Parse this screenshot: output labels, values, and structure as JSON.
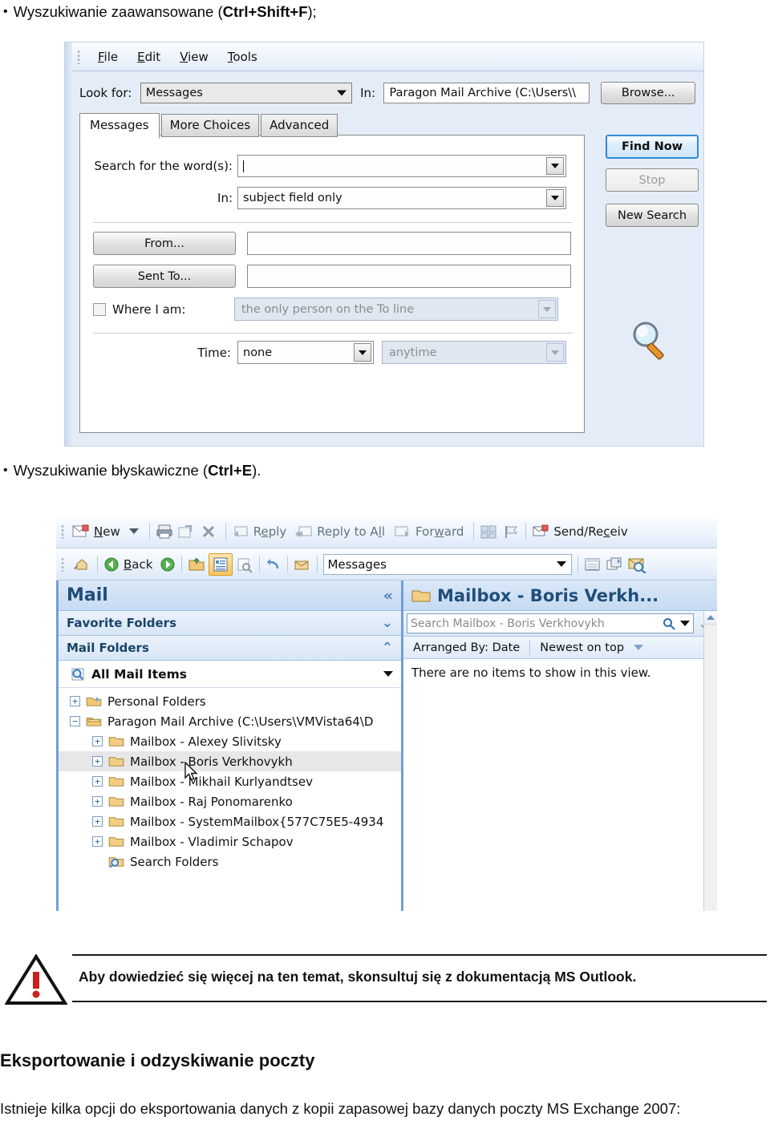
{
  "doc": {
    "bullet1": {
      "text_before": "Wyszukiwanie zaawansowane (",
      "bold": "Ctrl+Shift+F",
      "text_after": ");"
    },
    "bullet2": {
      "text_before": "Wyszukiwanie błyskawiczne (",
      "bold": "Ctrl+E",
      "text_after": ")."
    },
    "note": "Aby dowiedzieć się więcej na ten temat, skonsultuj się z dokumentacją MS Outlook.",
    "note_icon": "warning-triangle-icon",
    "heading": "Eksportowanie i odzyskiwanie poczty",
    "paragraph": "Istnieje kilka opcji do eksportowania danych z kopii zapasowej bazy danych poczty MS Exchange 2007:"
  },
  "find_dialog": {
    "menu": [
      "File",
      "Edit",
      "View",
      "Tools"
    ],
    "menu_mnemonics": [
      "F",
      "E",
      "V",
      "T"
    ],
    "look_for_label": "Look for:",
    "look_for_value": "Messages",
    "in_label": "In:",
    "in_value": "Paragon Mail Archive (C:\\Users\\\\",
    "browse_button": "Browse...",
    "buttons": {
      "find_now": "Find Now",
      "stop": "Stop",
      "new_search": "New Search"
    },
    "tabs": [
      {
        "label": "Messages",
        "active": true
      },
      {
        "label": "More Choices",
        "active": false
      },
      {
        "label": "Advanced",
        "active": false
      }
    ],
    "fields": {
      "search_words_label": "Search for the word(s):",
      "search_words_value": "",
      "in2_label": "In:",
      "in2_value": "subject field only",
      "from_button": "From...",
      "from_value": "",
      "sent_to_button": "Sent To...",
      "sent_to_value": "",
      "where_i_am_label": "Where I am:",
      "where_i_am_checked": false,
      "where_i_am_value": "the only person on the To line",
      "time_label": "Time:",
      "time_value": "none",
      "time_range_value": "anytime"
    },
    "magnifier_icon": "magnifier-icon"
  },
  "outlook": {
    "toolbar1": {
      "new_button": "New",
      "new_mnemonic": "N",
      "reply": "Reply",
      "reply_all": "Reply to All",
      "forward": "Forward",
      "send_receive": "Send/Receiv",
      "icons": [
        "new-mail-icon",
        "new-dropdown-arrow-icon",
        "print-icon",
        "move-to-folder-icon",
        "delete-icon",
        "reply-icon",
        "reply-all-icon",
        "forward-icon",
        "layout-icon",
        "flag-icon",
        "send-receive-icon"
      ]
    },
    "toolbar2": {
      "back": "Back",
      "back_mnemonic": "B",
      "search_scope": "Messages",
      "icons": [
        "home-icon",
        "back-arrow-icon",
        "forward-arrow-icon",
        "open-folder-icon",
        "reading-pane-icon",
        "print-preview-icon",
        "undo-icon",
        "mail-alert-icon",
        "list-view-icon",
        "arrange-icon",
        "find-icon"
      ]
    },
    "nav_pane": {
      "title": "Mail",
      "collapse_icon": "chevron-double-left-icon",
      "sections": [
        {
          "label": "Favorite Folders",
          "chevron": "chevron-double-down-icon"
        },
        {
          "label": "Mail Folders",
          "chevron": "chevron-double-up-icon"
        }
      ],
      "all_mail_items": "All Mail Items",
      "all_mail_icon": "search-folder-icon",
      "all_mail_caret": "caret-down-icon",
      "tree": [
        {
          "label": "Personal Folders",
          "indent": 0,
          "expander": "+",
          "icon": "personal-folders-icon",
          "selected": false
        },
        {
          "label": "Paragon Mail Archive (C:\\Users\\VMVista64\\D",
          "indent": 0,
          "expander": "-",
          "icon": "archive-folder-icon",
          "selected": false
        },
        {
          "label": "Mailbox - Alexey Slivitsky",
          "indent": 1,
          "expander": "+",
          "icon": "folder-icon",
          "selected": false
        },
        {
          "label": "Mailbox - Boris Verkhovykh",
          "indent": 1,
          "expander": "+",
          "icon": "folder-icon",
          "selected": true
        },
        {
          "label": "Mailbox - Mikhail Kurlyandtsev",
          "indent": 1,
          "expander": "+",
          "icon": "folder-icon",
          "selected": false
        },
        {
          "label": "Mailbox - Raj Ponomarenko",
          "indent": 1,
          "expander": "+",
          "icon": "folder-icon",
          "selected": false
        },
        {
          "label": "Mailbox - SystemMailbox{577C75E5-4934",
          "indent": 1,
          "expander": "+",
          "icon": "folder-icon",
          "selected": false
        },
        {
          "label": "Mailbox - Vladimir Schapov",
          "indent": 1,
          "expander": "+",
          "icon": "folder-icon",
          "selected": false
        },
        {
          "label": "Search Folders",
          "indent": 1,
          "expander": "",
          "icon": "search-folder-icon",
          "selected": false
        }
      ],
      "cursor_icon": "mouse-pointer-icon"
    },
    "list_pane": {
      "title": "Mailbox - Boris Verkh...",
      "title_icon": "folder-icon",
      "search_placeholder": "Search Mailbox - Boris Verkhovykh",
      "search_icon": "magnifier-icon",
      "search_caret": "caret-down-icon",
      "expand_icon": "chevron-double-down-icon",
      "arranged_by": "Arranged By: Date",
      "sort_order": "Newest on top",
      "sort_caret": "caret-down-icon",
      "empty_message": "There are no items to show in this view.",
      "scroll_up_icon": "scroll-up-arrow-icon"
    }
  },
  "colors": {
    "accent_blue": "#1f4e79",
    "dialog_bg": "#e4ecf7",
    "pane_border": "#6f9fd8",
    "warning_red": "#cc1f1f",
    "default_button_border": "#2f8ad6"
  }
}
